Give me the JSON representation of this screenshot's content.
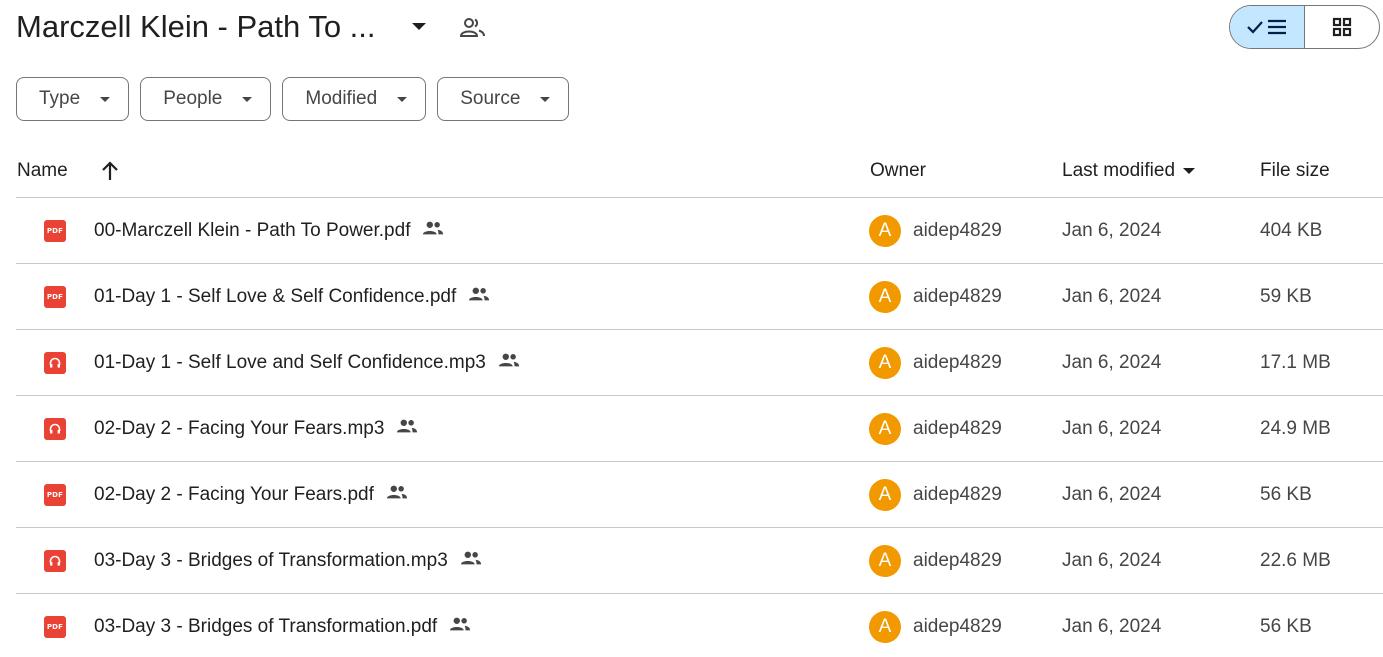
{
  "header": {
    "title": "Marczell Klein - Path To ...",
    "title_caret_icon": "caret-down-icon",
    "shared_icon": "people-outline-icon",
    "view_toggle": {
      "active": "list",
      "list_icon": "check-list-icon",
      "grid_icon": "grid-icon"
    }
  },
  "filters": [
    {
      "label": "Type"
    },
    {
      "label": "People"
    },
    {
      "label": "Modified"
    },
    {
      "label": "Source"
    }
  ],
  "table": {
    "columns": {
      "name": "Name",
      "owner": "Owner",
      "modified": "Last modified",
      "size": "File size"
    },
    "rows": [
      {
        "type": "pdf",
        "name": "00-Marczell Klein - Path To Power.pdf",
        "owner_initial": "A",
        "owner": "aidep4829",
        "modified": "Jan 6, 2024",
        "size": "404 KB"
      },
      {
        "type": "pdf",
        "name": "01-Day 1 - Self Love & Self Confidence.pdf",
        "owner_initial": "A",
        "owner": "aidep4829",
        "modified": "Jan 6, 2024",
        "size": "59 KB"
      },
      {
        "type": "audio",
        "name": "01-Day 1 - Self Love and Self Confidence.mp3",
        "owner_initial": "A",
        "owner": "aidep4829",
        "modified": "Jan 6, 2024",
        "size": "17.1 MB"
      },
      {
        "type": "audio",
        "name": "02-Day 2 - Facing Your Fears.mp3",
        "owner_initial": "A",
        "owner": "aidep4829",
        "modified": "Jan 6, 2024",
        "size": "24.9 MB"
      },
      {
        "type": "pdf",
        "name": "02-Day 2 - Facing Your Fears.pdf",
        "owner_initial": "A",
        "owner": "aidep4829",
        "modified": "Jan 6, 2024",
        "size": "56 KB"
      },
      {
        "type": "audio",
        "name": "03-Day 3 - Bridges of Transformation.mp3",
        "owner_initial": "A",
        "owner": "aidep4829",
        "modified": "Jan 6, 2024",
        "size": "22.6 MB"
      },
      {
        "type": "pdf",
        "name": "03-Day 3 - Bridges of Transformation.pdf",
        "owner_initial": "A",
        "owner": "aidep4829",
        "modified": "Jan 6, 2024",
        "size": "56 KB"
      }
    ]
  },
  "icons": {
    "pdf_label": "PDF",
    "pdf_color": "#ea4335",
    "audio_color": "#ea4335",
    "avatar_color": "#f29900"
  }
}
